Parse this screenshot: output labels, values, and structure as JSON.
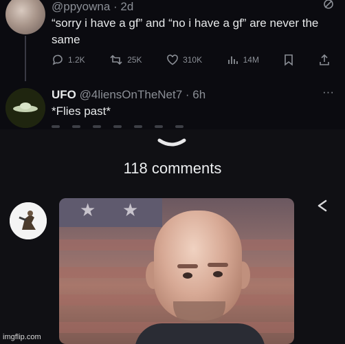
{
  "tweet": {
    "handle_line": "@ppyowna · 2d",
    "text": "“sorry i have a gf” and “no i have a gf” are never the same",
    "stats": {
      "replies": "1.2K",
      "reposts": "25K",
      "likes": "310K",
      "views": "14M"
    }
  },
  "reply": {
    "name": "UFO",
    "handle_time": "@4liensOnTheNet7 · 6h",
    "text": "*Flies past*"
  },
  "comments": {
    "count_label": "118 comments"
  },
  "watermark": "imgflip.com",
  "icons": [
    "more-dots-icon",
    "grok-icon",
    "reply-icon",
    "repost-icon",
    "like-icon",
    "views-icon",
    "bookmark-icon",
    "share-icon",
    "chevron-down-icon",
    "share-arrow-icon"
  ],
  "colors": {
    "background": "#0b0b10",
    "sheet": "#101014",
    "muted_text": "#8b8f96",
    "primary_text": "#e7e9ea"
  }
}
